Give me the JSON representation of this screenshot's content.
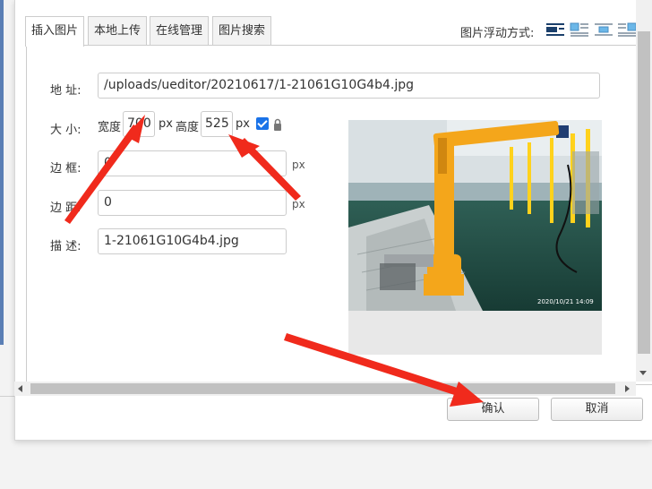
{
  "tabs": [
    {
      "label": "插入图片",
      "active": true
    },
    {
      "label": "本地上传",
      "active": false
    },
    {
      "label": "在线管理",
      "active": false
    },
    {
      "label": "图片搜索",
      "active": false
    }
  ],
  "float_label": "图片浮动方式:",
  "form": {
    "address_label": "地 址:",
    "address_value": "/uploads/ueditor/20210617/1-21061G10G4b4.jpg",
    "size_label": "大 小:",
    "width_label": "宽度",
    "width_value": "700",
    "height_label": "高度",
    "height_value": "525",
    "px": "px",
    "border_label": "边 框:",
    "border_value": "0",
    "margin_label": "边 距:",
    "margin_value": "0",
    "desc_label": "描 述:",
    "desc_value": "1-21061G10G4b4.jpg"
  },
  "preview": {
    "timestamp": "2020/10/21  14:09"
  },
  "buttons": {
    "confirm": "确认",
    "cancel": "取消"
  },
  "colors": {
    "accent": "#1a73e8",
    "annotation": "#f02a1c",
    "robot": "#f4a61b"
  }
}
